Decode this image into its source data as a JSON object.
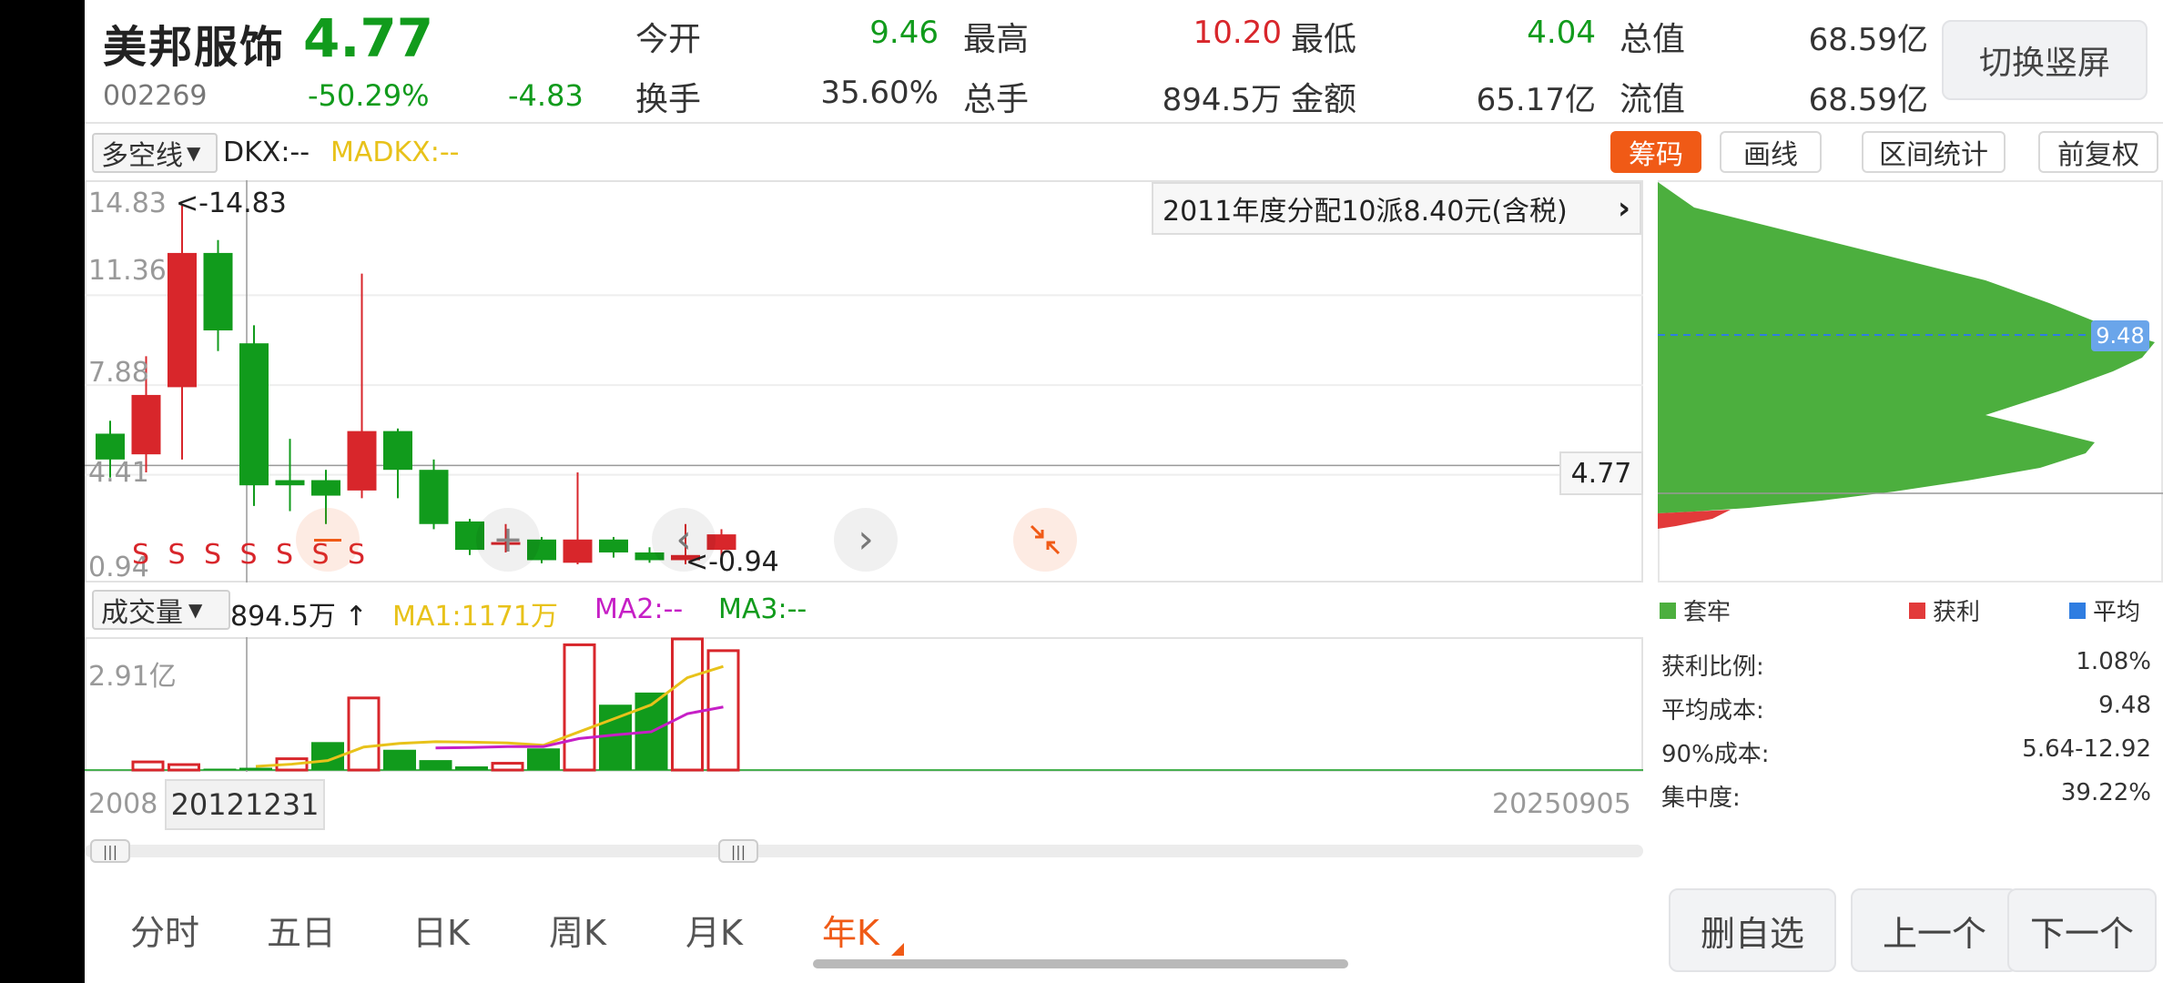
{
  "stock": {
    "name": "美邦服饰",
    "price": "4.77",
    "code": "002269",
    "change_pct": "-50.29%",
    "change": "-4.83"
  },
  "quote": {
    "open_label": "今开",
    "open": "9.46",
    "high_label": "最高",
    "high": "10.20",
    "low_label": "最低",
    "low": "4.04",
    "cap_label": "总值",
    "cap": "68.59亿",
    "turnover_label": "换手",
    "turnover": "35.60%",
    "vol_label": "总手",
    "vol": "894.5万",
    "amount_label": "金额",
    "amount": "65.17亿",
    "float_label": "流值",
    "float": "68.59亿"
  },
  "switch_button": "切换竖屏",
  "indicator": {
    "selector": "多空线",
    "dkx": "DKX:--",
    "madkx": "MADKX:--"
  },
  "right_tabs": [
    "筹码",
    "画线",
    "区间统计",
    "前复权"
  ],
  "price_chart": {
    "dividend_note": "2011年度分配10派8.40元(含税)",
    "y_labels": [
      "14.83",
      "11.36",
      "7.88",
      "4.41",
      "0.94"
    ],
    "max_marker": "<-14.83",
    "min_marker": "<-0.94",
    "current_price": "4.77",
    "s_marker": "S"
  },
  "volume_indicator": {
    "selector": "成交量",
    "vol": "894.5万",
    "ma1": "MA1:1171万",
    "ma2": "MA2:--",
    "ma3": "MA3:--",
    "y_label": "2.91亿"
  },
  "dates": {
    "start": "2008",
    "cursor": "20121231",
    "end": "20250905"
  },
  "chip": {
    "price_tag": "9.48",
    "legend": [
      "套牢",
      "获利",
      "平均"
    ],
    "stats": [
      {
        "label": "获利比例:",
        "value": "1.08%"
      },
      {
        "label": "平均成本:",
        "value": "9.48"
      },
      {
        "label": "90%成本:",
        "value": "5.64-12.92"
      },
      {
        "label": "集中度:",
        "value": "39.22%"
      }
    ]
  },
  "period_tabs": [
    "分时",
    "五日",
    "日K",
    "周K",
    "月K",
    "年K"
  ],
  "bottom_buttons": [
    "删自选",
    "上一个",
    "下一个"
  ],
  "colors": {
    "up": "#d8262b",
    "down": "#119b1c",
    "accent": "#f05a16",
    "ma1": "#e8c21a",
    "ma2": "#c61fc6",
    "ma3": "#119b1c"
  },
  "chart_data": {
    "type": "candlestick",
    "ylim": [
      0.94,
      14.83
    ],
    "candles": [
      {
        "o": 6.0,
        "c": 5.0,
        "h": 6.5,
        "l": 4.3
      },
      {
        "o": 5.2,
        "c": 7.5,
        "h": 9.0,
        "l": 4.5
      },
      {
        "o": 7.8,
        "c": 13.0,
        "h": 14.83,
        "l": 5.0
      },
      {
        "o": 13.0,
        "c": 10.0,
        "h": 13.5,
        "l": 9.2
      },
      {
        "o": 9.5,
        "c": 4.0,
        "h": 10.2,
        "l": 3.2
      },
      {
        "o": 4.2,
        "c": 4.0,
        "h": 5.8,
        "l": 3.0
      },
      {
        "o": 4.2,
        "c": 3.6,
        "h": 4.6,
        "l": 2.5
      },
      {
        "o": 3.8,
        "c": 6.1,
        "h": 12.2,
        "l": 3.5
      },
      {
        "o": 6.1,
        "c": 4.6,
        "h": 6.2,
        "l": 3.5
      },
      {
        "o": 4.6,
        "c": 2.5,
        "h": 5.0,
        "l": 2.3
      },
      {
        "o": 2.6,
        "c": 1.5,
        "h": 2.7,
        "l": 1.3
      },
      {
        "o": 1.7,
        "c": 1.8,
        "h": 2.5,
        "l": 1.4
      },
      {
        "o": 1.9,
        "c": 1.1,
        "h": 2.0,
        "l": 0.98
      },
      {
        "o": 1.0,
        "c": 1.9,
        "h": 4.5,
        "l": 0.94
      },
      {
        "o": 1.9,
        "c": 1.4,
        "h": 2.0,
        "l": 1.2
      },
      {
        "o": 1.4,
        "c": 1.1,
        "h": 1.6,
        "l": 1.0
      },
      {
        "o": 1.1,
        "c": 1.3,
        "h": 2.5,
        "l": 0.94
      },
      {
        "o": 1.5,
        "c": 2.1,
        "h": 2.3,
        "l": 1.2
      }
    ],
    "volume": [
      {
        "v": 0.0,
        "up": false
      },
      {
        "v": 0.18,
        "up": true
      },
      {
        "v": 0.12,
        "up": true
      },
      {
        "v": 0.03,
        "up": false
      },
      {
        "v": 0.05,
        "up": false
      },
      {
        "v": 0.25,
        "up": true
      },
      {
        "v": 0.62,
        "up": false
      },
      {
        "v": 1.6,
        "up": true
      },
      {
        "v": 0.45,
        "up": false
      },
      {
        "v": 0.22,
        "up": false
      },
      {
        "v": 0.08,
        "up": false
      },
      {
        "v": 0.15,
        "up": true
      },
      {
        "v": 0.48,
        "up": false
      },
      {
        "v": 2.78,
        "up": true
      },
      {
        "v": 1.45,
        "up": false
      },
      {
        "v": 1.72,
        "up": false
      },
      {
        "v": 2.91,
        "up": true
      },
      {
        "v": 2.65,
        "up": true
      }
    ],
    "vol_ylim": [
      0,
      2.91
    ],
    "ma1": [
      null,
      null,
      null,
      null,
      0.08,
      0.13,
      0.21,
      0.51,
      0.59,
      0.63,
      0.62,
      0.6,
      0.55,
      0.85,
      1.15,
      1.45,
      2.05,
      2.3
    ],
    "ma2": [
      null,
      null,
      null,
      null,
      null,
      null,
      null,
      null,
      null,
      0.49,
      0.5,
      0.52,
      0.52,
      0.7,
      0.78,
      0.85,
      1.25,
      1.4
    ]
  }
}
